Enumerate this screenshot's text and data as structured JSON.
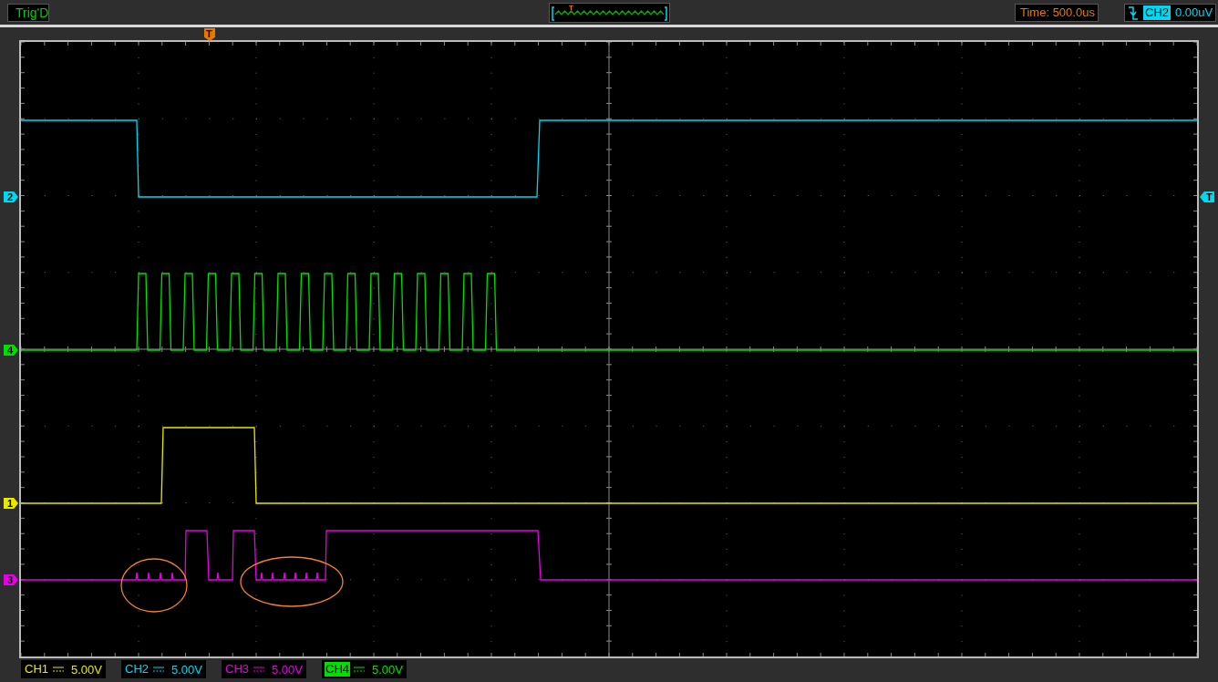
{
  "trigger_status": "Trig'D",
  "overview": {
    "trigger_label": "T"
  },
  "timebase": "Time: 500.0us",
  "trigger": {
    "channel": "CH2",
    "level": "0.00uV"
  },
  "trigger_position_marker": "T",
  "trigger_level_marker": "T",
  "channel_markers": [
    {
      "label": "2",
      "color": "#00d8f0"
    },
    {
      "label": "4",
      "color": "#00e000"
    },
    {
      "label": "1",
      "color": "#e8e800"
    },
    {
      "label": "3",
      "color": "#e600e6"
    }
  ],
  "channels": [
    {
      "name": "CH1",
      "scale": "5.00V",
      "color": "#e8e800",
      "selected": false
    },
    {
      "name": "CH2",
      "scale": "5.00V",
      "color": "#00d8f0",
      "selected": false
    },
    {
      "name": "CH3",
      "scale": "5.00V",
      "color": "#e600e6",
      "selected": false
    },
    {
      "name": "CH4",
      "scale": "5.00V",
      "color": "#00e000",
      "selected": true
    }
  ]
}
